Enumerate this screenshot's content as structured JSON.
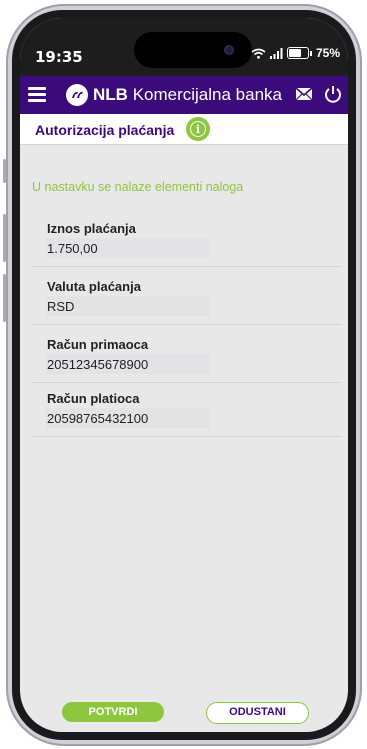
{
  "status_bar": {
    "time": "19:35",
    "battery": "75%"
  },
  "navbar": {
    "brand_bold": "NLB",
    "brand_rest": "Komercijalna banka"
  },
  "page": {
    "title": "Autorizacija plaćanja",
    "intro": "U nastavku se nalaze elementi naloga"
  },
  "fields": [
    {
      "label": "Iznos plaćanja",
      "value": "1.750,00"
    },
    {
      "label": "Valuta plaćanja",
      "value": "RSD"
    },
    {
      "label": "Račun primaoca",
      "value": "20512345678900"
    },
    {
      "label": "Račun platioca",
      "value": "20598765432100"
    }
  ],
  "actions": {
    "confirm": "POTVRDI",
    "cancel": "ODUSTANI"
  },
  "colors": {
    "brand_purple": "#3b0a7b",
    "accent_green": "#8dc63f"
  },
  "icons": [
    "menu-icon",
    "logo-icon",
    "mail-icon",
    "power-icon",
    "info-icon",
    "wifi-icon",
    "signal-icon",
    "battery-icon"
  ]
}
